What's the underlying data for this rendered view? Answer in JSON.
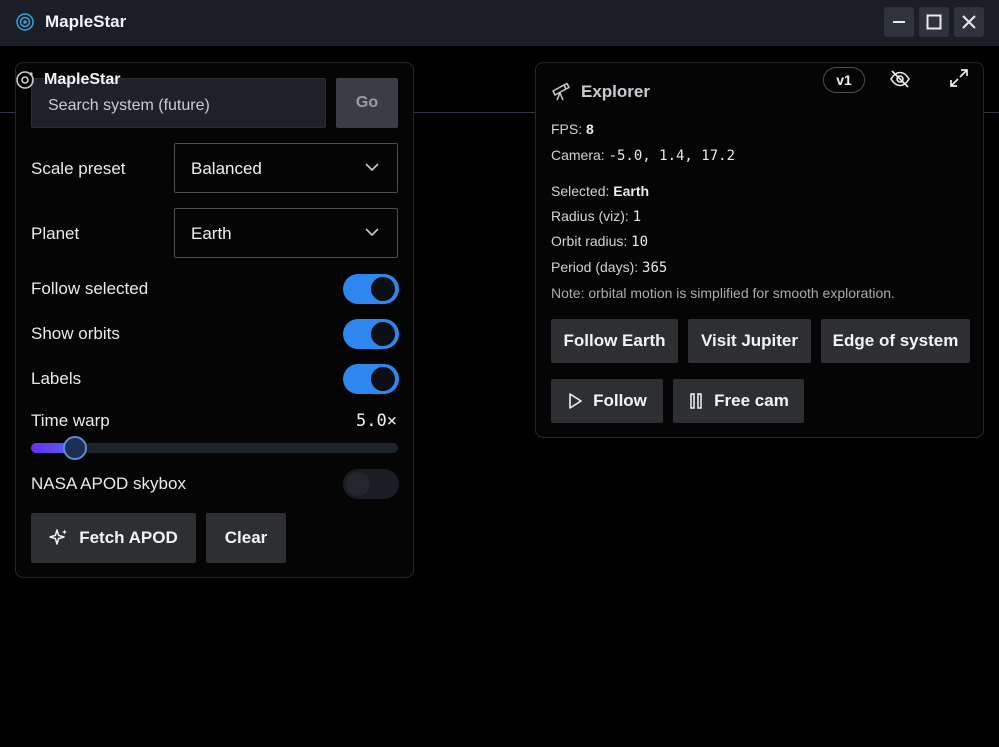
{
  "window": {
    "title": "MapleStar",
    "controls": [
      "minimize-icon",
      "maximize-icon",
      "close-icon"
    ]
  },
  "left_panel": {
    "brand": "MapleStar",
    "search": {
      "placeholder": "Search system (future)",
      "value": "",
      "button": "Go"
    },
    "scale_preset": {
      "label": "Scale preset",
      "value": "Balanced"
    },
    "planet": {
      "label": "Planet",
      "value": "Earth"
    },
    "toggles": [
      {
        "label": "Follow selected",
        "on": true
      },
      {
        "label": "Show orbits",
        "on": true
      },
      {
        "label": "Labels",
        "on": true
      }
    ],
    "time_warp": {
      "label": "Time warp",
      "value_text": "5.0×",
      "fraction": 0.12
    },
    "apod": {
      "label": "NASA APOD skybox",
      "on": false
    },
    "buttons": {
      "fetch": "Fetch APOD",
      "clear": "Clear"
    }
  },
  "explorer": {
    "title": "Explorer",
    "version_badge": "v1",
    "fps_label": "FPS:",
    "fps": "8",
    "camera_label": "Camera:",
    "camera": "-5.0, 1.4, 17.2",
    "selected_label": "Selected:",
    "selected": "Earth",
    "radius_label": "Radius (viz):",
    "radius": "1",
    "orbit_label": "Orbit radius:",
    "orbit": "10",
    "period_label": "Period (days):",
    "period": "365",
    "note": "Note: orbital motion is simplified for smooth exploration.",
    "actions": {
      "follow_earth": "Follow Earth",
      "visit_jupiter": "Visit Jupiter",
      "edge": "Edge of system",
      "follow": "Follow",
      "free_cam": "Free cam"
    }
  },
  "colors": {
    "accent": "#2f86ee",
    "background": "#000000",
    "titlebar": "#1b1e25",
    "slider": "#6a2ef0"
  }
}
